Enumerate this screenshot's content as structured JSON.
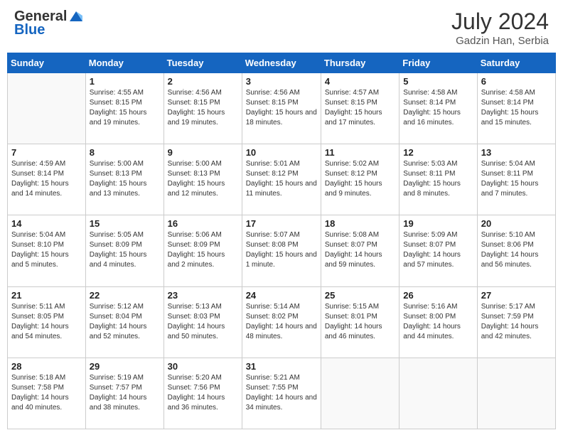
{
  "header": {
    "logo_line1": "General",
    "logo_line2": "Blue",
    "month_year": "July 2024",
    "location": "Gadzin Han, Serbia"
  },
  "weekdays": [
    "Sunday",
    "Monday",
    "Tuesday",
    "Wednesday",
    "Thursday",
    "Friday",
    "Saturday"
  ],
  "weeks": [
    [
      {
        "day": "",
        "empty": true
      },
      {
        "day": "1",
        "sunrise": "Sunrise: 4:55 AM",
        "sunset": "Sunset: 8:15 PM",
        "daylight": "Daylight: 15 hours and 19 minutes."
      },
      {
        "day": "2",
        "sunrise": "Sunrise: 4:56 AM",
        "sunset": "Sunset: 8:15 PM",
        "daylight": "Daylight: 15 hours and 19 minutes."
      },
      {
        "day": "3",
        "sunrise": "Sunrise: 4:56 AM",
        "sunset": "Sunset: 8:15 PM",
        "daylight": "Daylight: 15 hours and 18 minutes."
      },
      {
        "day": "4",
        "sunrise": "Sunrise: 4:57 AM",
        "sunset": "Sunset: 8:15 PM",
        "daylight": "Daylight: 15 hours and 17 minutes."
      },
      {
        "day": "5",
        "sunrise": "Sunrise: 4:58 AM",
        "sunset": "Sunset: 8:14 PM",
        "daylight": "Daylight: 15 hours and 16 minutes."
      },
      {
        "day": "6",
        "sunrise": "Sunrise: 4:58 AM",
        "sunset": "Sunset: 8:14 PM",
        "daylight": "Daylight: 15 hours and 15 minutes."
      }
    ],
    [
      {
        "day": "7",
        "sunrise": "Sunrise: 4:59 AM",
        "sunset": "Sunset: 8:14 PM",
        "daylight": "Daylight: 15 hours and 14 minutes."
      },
      {
        "day": "8",
        "sunrise": "Sunrise: 5:00 AM",
        "sunset": "Sunset: 8:13 PM",
        "daylight": "Daylight: 15 hours and 13 minutes."
      },
      {
        "day": "9",
        "sunrise": "Sunrise: 5:00 AM",
        "sunset": "Sunset: 8:13 PM",
        "daylight": "Daylight: 15 hours and 12 minutes."
      },
      {
        "day": "10",
        "sunrise": "Sunrise: 5:01 AM",
        "sunset": "Sunset: 8:12 PM",
        "daylight": "Daylight: 15 hours and 11 minutes."
      },
      {
        "day": "11",
        "sunrise": "Sunrise: 5:02 AM",
        "sunset": "Sunset: 8:12 PM",
        "daylight": "Daylight: 15 hours and 9 minutes."
      },
      {
        "day": "12",
        "sunrise": "Sunrise: 5:03 AM",
        "sunset": "Sunset: 8:11 PM",
        "daylight": "Daylight: 15 hours and 8 minutes."
      },
      {
        "day": "13",
        "sunrise": "Sunrise: 5:04 AM",
        "sunset": "Sunset: 8:11 PM",
        "daylight": "Daylight: 15 hours and 7 minutes."
      }
    ],
    [
      {
        "day": "14",
        "sunrise": "Sunrise: 5:04 AM",
        "sunset": "Sunset: 8:10 PM",
        "daylight": "Daylight: 15 hours and 5 minutes."
      },
      {
        "day": "15",
        "sunrise": "Sunrise: 5:05 AM",
        "sunset": "Sunset: 8:09 PM",
        "daylight": "Daylight: 15 hours and 4 minutes."
      },
      {
        "day": "16",
        "sunrise": "Sunrise: 5:06 AM",
        "sunset": "Sunset: 8:09 PM",
        "daylight": "Daylight: 15 hours and 2 minutes."
      },
      {
        "day": "17",
        "sunrise": "Sunrise: 5:07 AM",
        "sunset": "Sunset: 8:08 PM",
        "daylight": "Daylight: 15 hours and 1 minute."
      },
      {
        "day": "18",
        "sunrise": "Sunrise: 5:08 AM",
        "sunset": "Sunset: 8:07 PM",
        "daylight": "Daylight: 14 hours and 59 minutes."
      },
      {
        "day": "19",
        "sunrise": "Sunrise: 5:09 AM",
        "sunset": "Sunset: 8:07 PM",
        "daylight": "Daylight: 14 hours and 57 minutes."
      },
      {
        "day": "20",
        "sunrise": "Sunrise: 5:10 AM",
        "sunset": "Sunset: 8:06 PM",
        "daylight": "Daylight: 14 hours and 56 minutes."
      }
    ],
    [
      {
        "day": "21",
        "sunrise": "Sunrise: 5:11 AM",
        "sunset": "Sunset: 8:05 PM",
        "daylight": "Daylight: 14 hours and 54 minutes."
      },
      {
        "day": "22",
        "sunrise": "Sunrise: 5:12 AM",
        "sunset": "Sunset: 8:04 PM",
        "daylight": "Daylight: 14 hours and 52 minutes."
      },
      {
        "day": "23",
        "sunrise": "Sunrise: 5:13 AM",
        "sunset": "Sunset: 8:03 PM",
        "daylight": "Daylight: 14 hours and 50 minutes."
      },
      {
        "day": "24",
        "sunrise": "Sunrise: 5:14 AM",
        "sunset": "Sunset: 8:02 PM",
        "daylight": "Daylight: 14 hours and 48 minutes."
      },
      {
        "day": "25",
        "sunrise": "Sunrise: 5:15 AM",
        "sunset": "Sunset: 8:01 PM",
        "daylight": "Daylight: 14 hours and 46 minutes."
      },
      {
        "day": "26",
        "sunrise": "Sunrise: 5:16 AM",
        "sunset": "Sunset: 8:00 PM",
        "daylight": "Daylight: 14 hours and 44 minutes."
      },
      {
        "day": "27",
        "sunrise": "Sunrise: 5:17 AM",
        "sunset": "Sunset: 7:59 PM",
        "daylight": "Daylight: 14 hours and 42 minutes."
      }
    ],
    [
      {
        "day": "28",
        "sunrise": "Sunrise: 5:18 AM",
        "sunset": "Sunset: 7:58 PM",
        "daylight": "Daylight: 14 hours and 40 minutes."
      },
      {
        "day": "29",
        "sunrise": "Sunrise: 5:19 AM",
        "sunset": "Sunset: 7:57 PM",
        "daylight": "Daylight: 14 hours and 38 minutes."
      },
      {
        "day": "30",
        "sunrise": "Sunrise: 5:20 AM",
        "sunset": "Sunset: 7:56 PM",
        "daylight": "Daylight: 14 hours and 36 minutes."
      },
      {
        "day": "31",
        "sunrise": "Sunrise: 5:21 AM",
        "sunset": "Sunset: 7:55 PM",
        "daylight": "Daylight: 14 hours and 34 minutes."
      },
      {
        "day": "",
        "empty": true
      },
      {
        "day": "",
        "empty": true
      },
      {
        "day": "",
        "empty": true
      }
    ]
  ]
}
